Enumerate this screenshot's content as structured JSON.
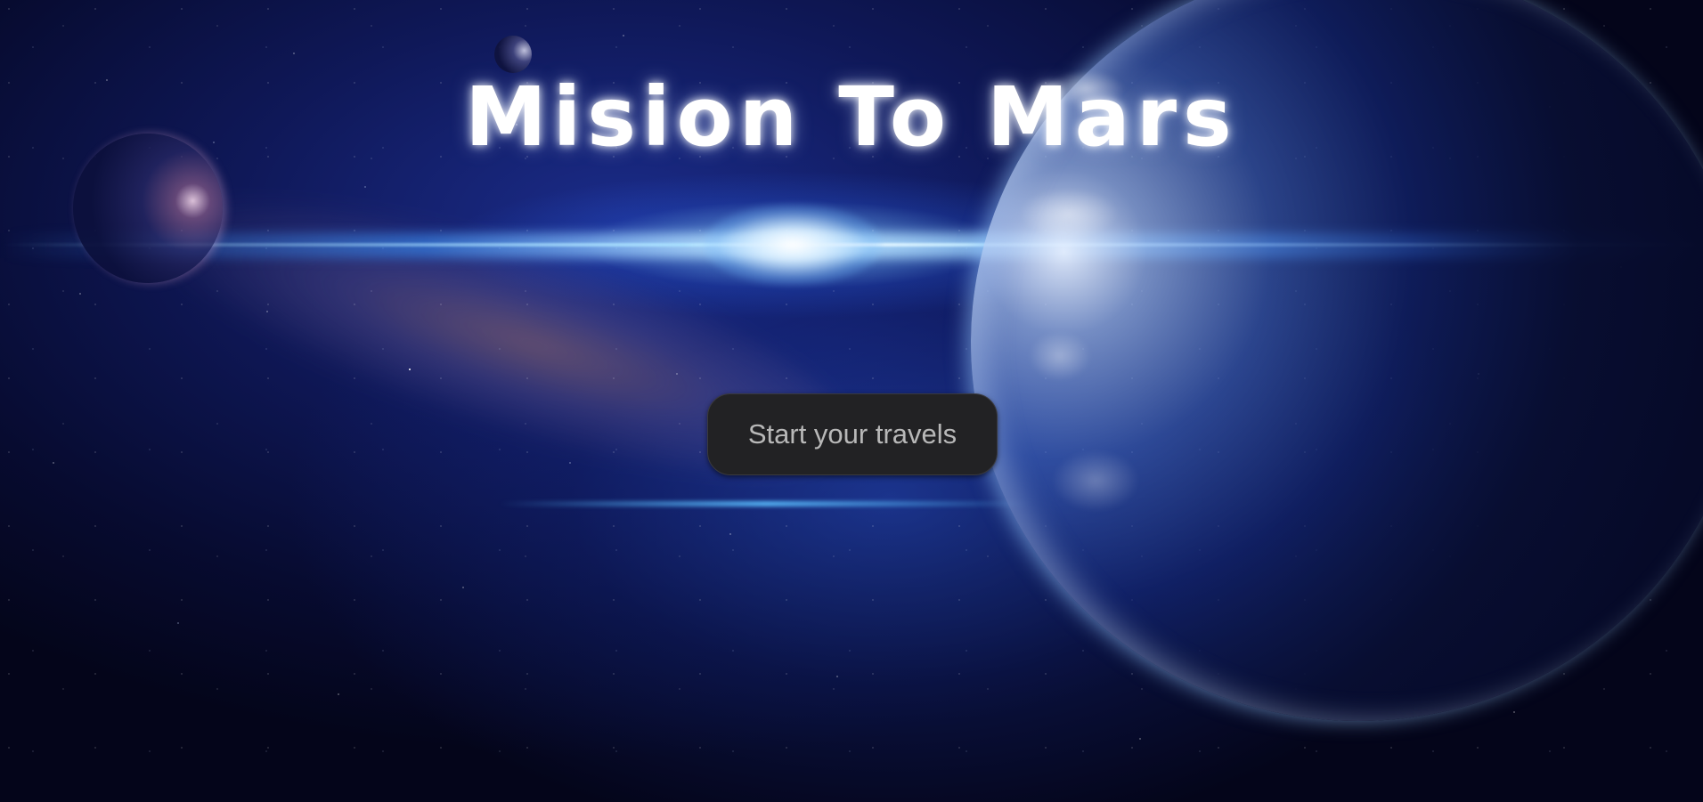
{
  "hero": {
    "title": "Mision To Mars",
    "cta_label": "Start your travels"
  },
  "colors": {
    "background": "#05061a",
    "title": "#ffffff",
    "cta_background": "#222224",
    "cta_text": "#b8b8b8"
  }
}
